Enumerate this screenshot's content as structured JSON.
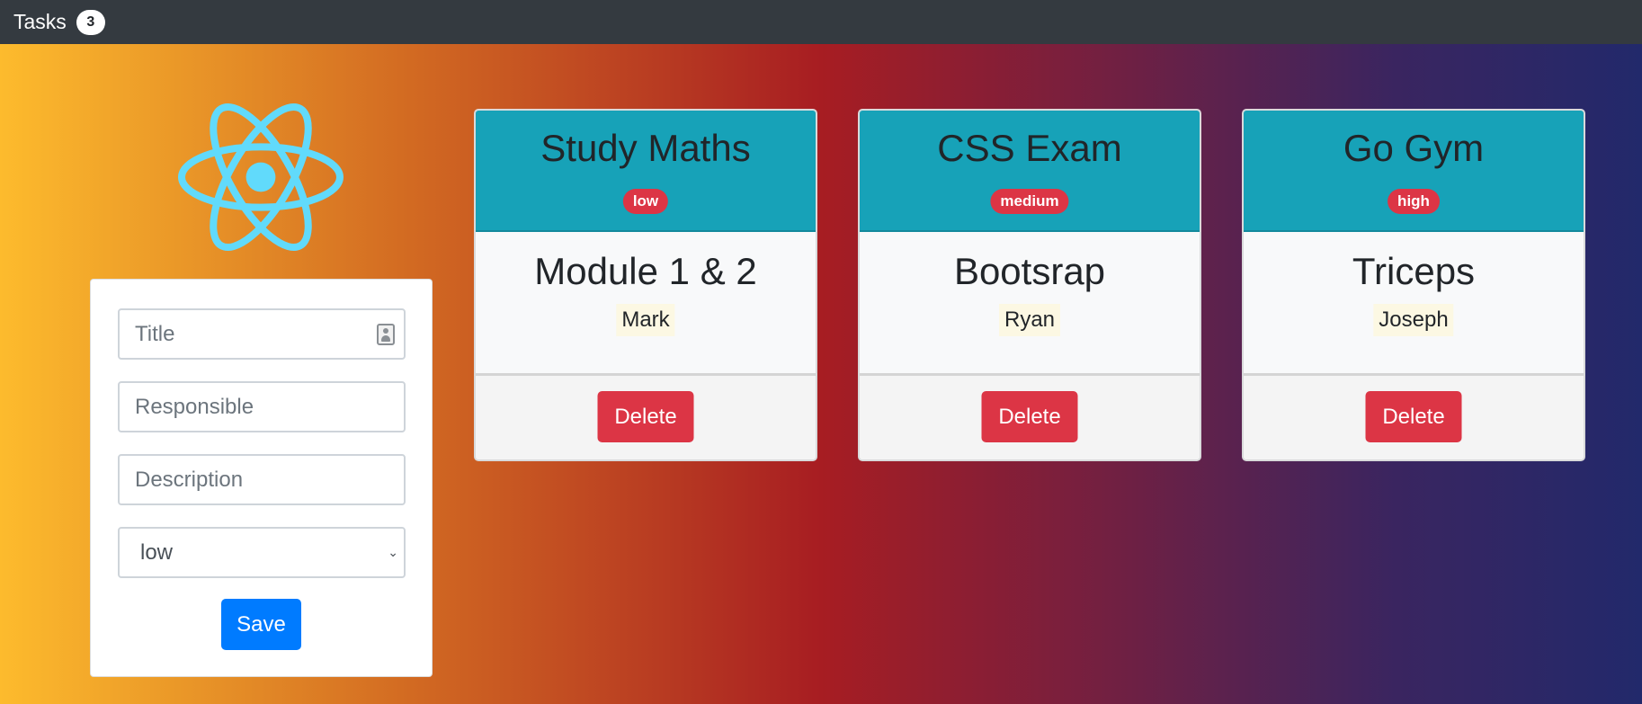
{
  "navbar": {
    "brand": "Tasks",
    "count": "3"
  },
  "logo": {
    "icon": "react-atom-icon",
    "color": "#61dafb"
  },
  "form": {
    "title_placeholder": "Title",
    "responsible_placeholder": "Responsible",
    "description_placeholder": "Description",
    "priority_selected": "low",
    "save_label": "Save"
  },
  "tasks": [
    {
      "title": "Study Maths",
      "priority": "low",
      "description": "Module 1 & 2",
      "responsible": "Mark",
      "delete_label": "Delete"
    },
    {
      "title": "CSS Exam",
      "priority": "medium",
      "description": "Bootsrap",
      "responsible": "Ryan",
      "delete_label": "Delete"
    },
    {
      "title": "Go Gym",
      "priority": "high",
      "description": "Triceps",
      "responsible": "Joseph",
      "delete_label": "Delete"
    }
  ],
  "colors": {
    "navbar": "#343a40",
    "card_header": "#17a2b8",
    "badge": "#dc3545",
    "save_button": "#007bff",
    "delete_button": "#dc3545"
  }
}
